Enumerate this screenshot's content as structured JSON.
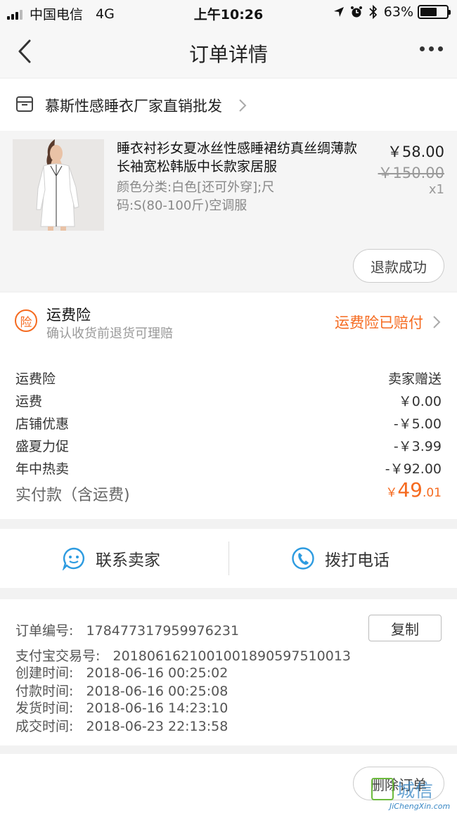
{
  "status_bar": {
    "carrier": "中国电信",
    "network": "4G",
    "time": "上午10:26",
    "battery_text": "63%",
    "battery_level": 0.63
  },
  "nav": {
    "title": "订单详情",
    "back_icon": "chevron-left-icon",
    "more_icon": "more-dots-icon"
  },
  "shop": {
    "name": "慕斯性感睡衣厂家直销批发",
    "icon": "store-icon"
  },
  "product": {
    "title": "睡衣衬衫女夏冰丝性感睡裙纺真丝绸薄款长袖宽松韩版中长款家居服",
    "sku": "颜色分类:白色[还可外穿];尺码:S(80-100斤)空调服",
    "price": "￥58.00",
    "original_price": "￥150.00",
    "quantity": "x1",
    "refund_status": "退款成功"
  },
  "insurance": {
    "icon_label": "险",
    "title": "运费险",
    "subtitle": "确认收货前退货可理赔",
    "status": "运费险已赔付"
  },
  "fees": [
    {
      "label": "运费险",
      "value": "卖家赠送"
    },
    {
      "label": "运费",
      "value": "￥0.00"
    },
    {
      "label": "店铺优惠",
      "value": "-￥5.00"
    },
    {
      "label": "盛夏力促",
      "value": "-￥3.99"
    },
    {
      "label": "年中热卖",
      "value": "-￥92.00"
    }
  ],
  "total": {
    "label": "实付款（含运费)",
    "currency": "￥",
    "integer": "49",
    "decimal": ".01"
  },
  "contact": {
    "seller_label": "联系卖家",
    "phone_label": "拨打电话"
  },
  "order_info": {
    "order_no": "订单编号:   178477317959976231",
    "alipay_no": "支付宝交易号:   2018061621001001890597510013",
    "created": "创建时间:   2018-06-16 00:25:02",
    "paid": "付款时间:   2018-06-16 00:25:08",
    "shipped": "发货时间:   2018-06-16 14:23:10",
    "completed": "成交时间:   2018-06-23 22:13:58",
    "copy_label": "复制"
  },
  "bottom": {
    "delete_label": "删除订单"
  },
  "watermark": {
    "text": "城信",
    "url": "JiChengXin.com"
  },
  "colors": {
    "accent": "#f56a1f",
    "contact_blue": "#2d9be0"
  }
}
